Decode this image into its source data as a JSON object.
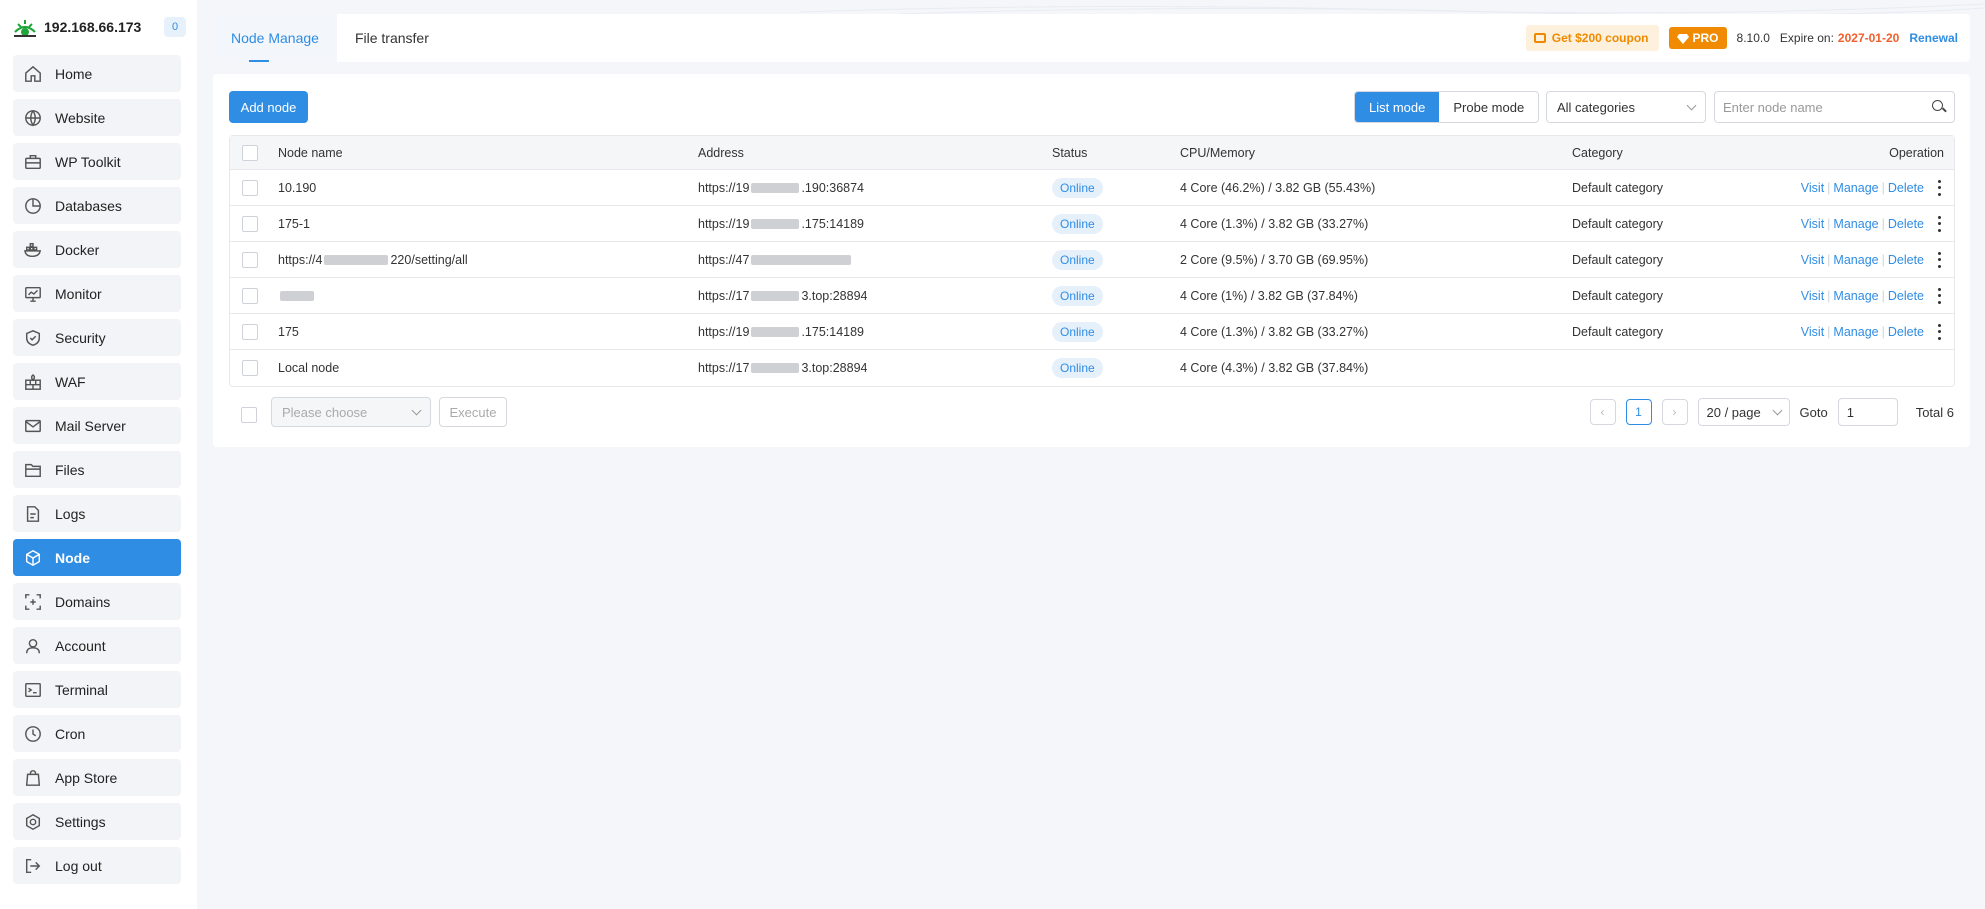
{
  "sidebar": {
    "ip": "192.168.66.173",
    "count": "0",
    "items": [
      {
        "label": "Home",
        "icon": "home-icon"
      },
      {
        "label": "Website",
        "icon": "globe-icon"
      },
      {
        "label": "WP Toolkit",
        "icon": "wp-toolkit-icon"
      },
      {
        "label": "Databases",
        "icon": "database-icon"
      },
      {
        "label": "Docker",
        "icon": "docker-icon"
      },
      {
        "label": "Monitor",
        "icon": "monitor-icon"
      },
      {
        "label": "Security",
        "icon": "shield-icon"
      },
      {
        "label": "WAF",
        "icon": "firewall-icon"
      },
      {
        "label": "Mail Server",
        "icon": "mail-icon"
      },
      {
        "label": "Files",
        "icon": "folder-icon"
      },
      {
        "label": "Logs",
        "icon": "log-file-icon"
      },
      {
        "label": "Node",
        "icon": "node-cube-icon"
      },
      {
        "label": "Domains",
        "icon": "domain-icon"
      },
      {
        "label": "Account",
        "icon": "user-icon"
      },
      {
        "label": "Terminal",
        "icon": "terminal-icon"
      },
      {
        "label": "Cron",
        "icon": "clock-icon"
      },
      {
        "label": "App Store",
        "icon": "store-bag-icon"
      },
      {
        "label": "Settings",
        "icon": "settings-icon"
      },
      {
        "label": "Log out",
        "icon": "logout-icon"
      }
    ],
    "active_index": 11
  },
  "header": {
    "tabs": [
      "Node Manage",
      "File transfer"
    ],
    "coupon": "Get $200 coupon",
    "pro": "PRO",
    "version": "8.10.0",
    "expire_label": "Expire on:",
    "expire_date": "2027-01-20",
    "renewal": "Renewal"
  },
  "toolbar": {
    "add_node": "Add node",
    "list_mode": "List mode",
    "probe_mode": "Probe mode",
    "category_select": "All categories",
    "search_placeholder": "Enter node name"
  },
  "table": {
    "columns": [
      "Node name",
      "Address",
      "Status",
      "CPU/Memory",
      "Category",
      "Operation"
    ],
    "rows": [
      {
        "name": "10.190",
        "addr_prefix": "https://19",
        "addr_suffix": ".190:36874",
        "status": "Online",
        "cpu": "4 Core (46.2%) / 3.82 GB (55.43%)",
        "category": "Default category",
        "ops": true
      },
      {
        "name": "175-1",
        "addr_prefix": "https://19",
        "addr_suffix": ".175:14189",
        "status": "Online",
        "cpu": "4 Core (1.3%) / 3.82 GB (33.27%)",
        "category": "Default category",
        "ops": true
      },
      {
        "name_prefix": "https://4",
        "name_suffix": "220/setting/all",
        "addr_prefix": "https://47",
        "addr_suffix": "",
        "status": "Online",
        "cpu": "2 Core (9.5%) / 3.70 GB (69.95%)",
        "category": "Default category",
        "ops": true
      },
      {
        "name": "",
        "addr_prefix": "https://17",
        "addr_suffix": "3.top:28894",
        "status": "Online",
        "cpu": "4 Core (1%) / 3.82 GB (37.84%)",
        "category": "Default category",
        "ops": true
      },
      {
        "name": "175",
        "addr_prefix": "https://19",
        "addr_suffix": ".175:14189",
        "status": "Online",
        "cpu": "4 Core (1.3%) / 3.82 GB (33.27%)",
        "category": "Default category",
        "ops": true
      },
      {
        "name": "Local node",
        "addr_prefix": "https://17",
        "addr_suffix": "3.top:28894",
        "status": "Online",
        "cpu": "4 Core (4.3%) / 3.82 GB (37.84%)",
        "category": "",
        "ops": false
      }
    ],
    "op_labels": {
      "visit": "Visit",
      "manage": "Manage",
      "delete": "Delete"
    }
  },
  "footer": {
    "batch_placeholder": "Please choose",
    "execute": "Execute",
    "prev": "‹",
    "page": "1",
    "next": "›",
    "page_size": "20 / page",
    "goto_label": "Goto",
    "goto_value": "1",
    "total": "Total 6"
  },
  "colors": {
    "accent": "#2f8de4",
    "pro_orange": "#f08a00",
    "expire_red": "#f25f2c"
  }
}
